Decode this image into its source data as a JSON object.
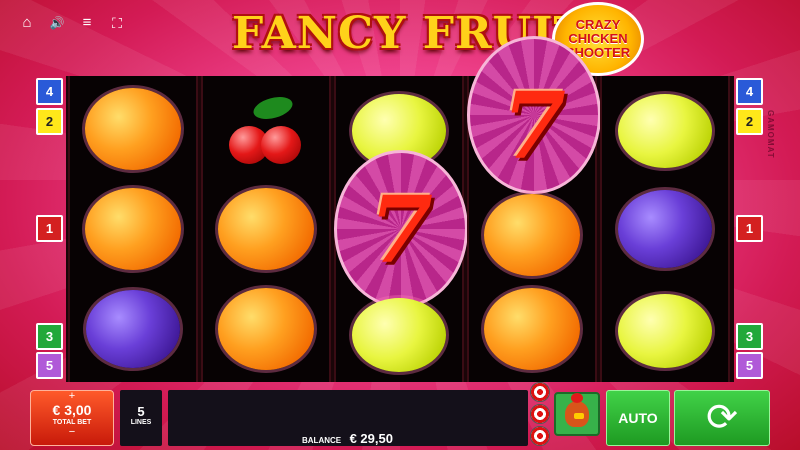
{
  "game": {
    "title": "FANCY FRUITS",
    "badge_lines": [
      "CRAZY",
      "CHICKEN",
      "SHOOTER"
    ],
    "vendor": "GAMOMAT"
  },
  "top_bar": {
    "home_icon": "⌂",
    "sound_icon": "🔊",
    "menu_icon": "≡",
    "fullscreen_icon": "⛶"
  },
  "line_indicators": {
    "left": [
      "4",
      "2",
      "1",
      "3",
      "5"
    ],
    "right": [
      "4",
      "2",
      "1",
      "3",
      "5"
    ],
    "colors": {
      "1": "#d42020",
      "2": "#ffe81a",
      "3": "#22a83a",
      "4": "#2a5ad8",
      "5": "#b05ad8"
    }
  },
  "reels": [
    [
      "orange",
      "orange",
      "plum"
    ],
    [
      "cherry",
      "orange",
      "orange"
    ],
    [
      "lemon",
      "seven",
      "lemon"
    ],
    [
      "seven",
      "orange",
      "orange"
    ],
    [
      "lemon",
      "plum",
      "lemon"
    ]
  ],
  "symbols": {
    "seven": "7"
  },
  "controls": {
    "bet_plus": "+",
    "bet_value": "€ 3,00",
    "bet_label": "TOTAL BET",
    "bet_minus": "−",
    "lines_value": "5",
    "lines_label": "LINES",
    "balance_label": "BALANCE",
    "balance_value": "€ 29,50",
    "auto_label": "AUTO",
    "spin_icon": "⟳"
  }
}
